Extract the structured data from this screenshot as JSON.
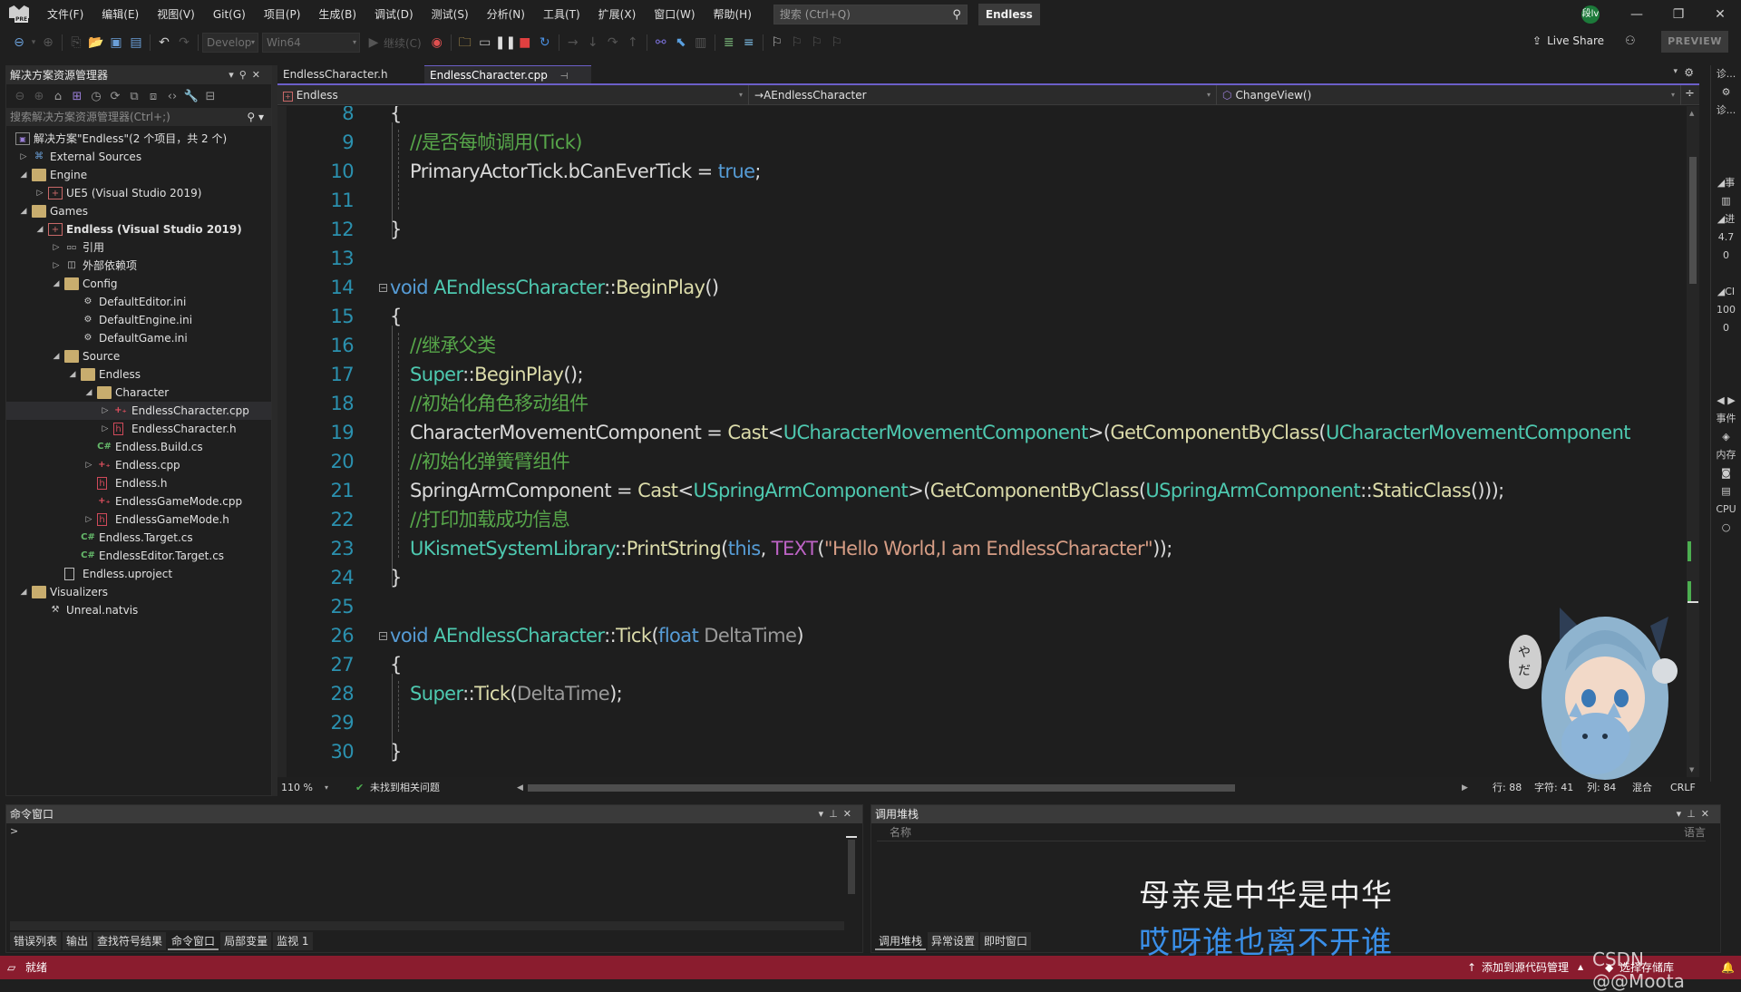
{
  "menu": {
    "items": [
      "文件(F)",
      "编辑(E)",
      "视图(V)",
      "Git(G)",
      "项目(P)",
      "生成(B)",
      "调试(D)",
      "测试(S)",
      "分析(N)",
      "工具(T)",
      "扩展(X)",
      "窗口(W)",
      "帮助(H)"
    ],
    "search_placeholder": "搜索 (Ctrl+Q)",
    "solution_name": "Endless",
    "account_initials": "段lv"
  },
  "toolbar": {
    "config": "Develop",
    "platform": "Win64",
    "continue_label": "继续(C)",
    "live_share": "Live Share",
    "preview": "PREVIEW"
  },
  "solution_explorer": {
    "title": "解决方案资源管理器",
    "search_placeholder": "搜索解决方案资源管理器(Ctrl+;)",
    "items": [
      {
        "label": "解决方案\"Endless\"(2 个项目，共 2 个)",
        "depth": 0,
        "icon": "solution",
        "arrow": ""
      },
      {
        "label": "External Sources",
        "depth": 1,
        "icon": "external",
        "arrow": "collapsed"
      },
      {
        "label": "Engine",
        "depth": 1,
        "icon": "folder",
        "arrow": "expanded"
      },
      {
        "label": "UE5 (Visual Studio 2019)",
        "depth": 2,
        "icon": "project",
        "arrow": "collapsed"
      },
      {
        "label": "Games",
        "depth": 1,
        "icon": "folder",
        "arrow": "expanded"
      },
      {
        "label": "Endless (Visual Studio 2019)",
        "depth": 2,
        "icon": "project",
        "arrow": "expanded",
        "bold": true
      },
      {
        "label": "引用",
        "depth": 3,
        "icon": "references",
        "arrow": "collapsed"
      },
      {
        "label": "外部依赖项",
        "depth": 3,
        "icon": "dependencies",
        "arrow": "collapsed"
      },
      {
        "label": "Config",
        "depth": 3,
        "icon": "filter-folder",
        "arrow": "expanded"
      },
      {
        "label": "DefaultEditor.ini",
        "depth": 4,
        "icon": "config-file",
        "arrow": ""
      },
      {
        "label": "DefaultEngine.ini",
        "depth": 4,
        "icon": "config-file",
        "arrow": ""
      },
      {
        "label": "DefaultGame.ini",
        "depth": 4,
        "icon": "config-file",
        "arrow": ""
      },
      {
        "label": "Source",
        "depth": 3,
        "icon": "filter-folder",
        "arrow": "expanded"
      },
      {
        "label": "Endless",
        "depth": 4,
        "icon": "filter-folder",
        "arrow": "expanded"
      },
      {
        "label": "Character",
        "depth": 5,
        "icon": "filter-folder",
        "arrow": "expanded"
      },
      {
        "label": "EndlessCharacter.cpp",
        "depth": 6,
        "icon": "cpp",
        "arrow": "collapsed",
        "selected": true
      },
      {
        "label": "EndlessCharacter.h",
        "depth": 6,
        "icon": "header",
        "arrow": "collapsed"
      },
      {
        "label": "Endless.Build.cs",
        "depth": 5,
        "icon": "csharp",
        "arrow": ""
      },
      {
        "label": "Endless.cpp",
        "depth": 5,
        "icon": "cpp",
        "arrow": "collapsed"
      },
      {
        "label": "Endless.h",
        "depth": 5,
        "icon": "header",
        "arrow": ""
      },
      {
        "label": "EndlessGameMode.cpp",
        "depth": 5,
        "icon": "cpp",
        "arrow": ""
      },
      {
        "label": "EndlessGameMode.h",
        "depth": 5,
        "icon": "header",
        "arrow": "collapsed"
      },
      {
        "label": "Endless.Target.cs",
        "depth": 4,
        "icon": "csharp",
        "arrow": ""
      },
      {
        "label": "EndlessEditor.Target.cs",
        "depth": 4,
        "icon": "csharp",
        "arrow": ""
      },
      {
        "label": "Endless.uproject",
        "depth": 3,
        "icon": "file",
        "arrow": ""
      },
      {
        "label": "Visualizers",
        "depth": 1,
        "icon": "folder",
        "arrow": "expanded"
      },
      {
        "label": "Unreal.natvis",
        "depth": 2,
        "icon": "natvis",
        "arrow": ""
      }
    ]
  },
  "editor": {
    "tabs": [
      {
        "label": "EndlessCharacter.h",
        "active": false
      },
      {
        "label": "EndlessCharacter.cpp",
        "active": true
      }
    ],
    "nav": {
      "project": "Endless",
      "scope": "AEndlessCharacter",
      "member": "ChangeView()"
    },
    "zoom": "110 %",
    "issues": "未找到相关问题",
    "line_label": "行: 88",
    "char_label": "字符: 41",
    "col_label": "列: 84",
    "indent": "混合",
    "eol": "CRLF",
    "lines": [
      {
        "n": 8,
        "tokens": [
          [
            "{",
            "w"
          ]
        ]
      },
      {
        "n": 9,
        "tokens": [
          [
            "//是否每帧调用(Tick)",
            "c_"
          ]
        ]
      },
      {
        "n": 10,
        "tokens": [
          [
            "PrimaryActorTick.bCanEverTick = ",
            "w"
          ],
          [
            "true",
            "k"
          ],
          [
            ";",
            "w"
          ]
        ]
      },
      {
        "n": 11,
        "tokens": []
      },
      {
        "n": 12,
        "tokens": [
          [
            "}",
            "w"
          ]
        ]
      },
      {
        "n": 13,
        "tokens": []
      },
      {
        "n": 14,
        "tokens": [
          [
            "void ",
            "k"
          ],
          [
            "AEndlessCharacter",
            "t"
          ],
          [
            "::",
            "w"
          ],
          [
            "BeginPlay",
            "f"
          ],
          [
            "()",
            "w"
          ]
        ],
        "fold": true
      },
      {
        "n": 15,
        "tokens": [
          [
            "{",
            "w"
          ]
        ]
      },
      {
        "n": 16,
        "tokens": [
          [
            "//继承父类",
            "c_"
          ]
        ]
      },
      {
        "n": 17,
        "tokens": [
          [
            "Super",
            "t"
          ],
          [
            "::",
            "w"
          ],
          [
            "BeginPlay",
            "f"
          ],
          [
            "();",
            "w"
          ]
        ]
      },
      {
        "n": 18,
        "tokens": [
          [
            "//初始化角色移动组件",
            "c_"
          ]
        ]
      },
      {
        "n": 19,
        "tokens": [
          [
            "CharacterMovementComponent = ",
            "w"
          ],
          [
            "Cast",
            "f"
          ],
          [
            "<",
            "w"
          ],
          [
            "UCharacterMovementComponent",
            "t"
          ],
          [
            ">(",
            "w"
          ],
          [
            "GetComponentByClass",
            "f"
          ],
          [
            "(",
            "w"
          ],
          [
            "UCharacterMovementComponent",
            "t"
          ]
        ]
      },
      {
        "n": 20,
        "tokens": [
          [
            "//初始化弹簧臂组件",
            "c_"
          ]
        ]
      },
      {
        "n": 21,
        "tokens": [
          [
            "SpringArmComponent = ",
            "w"
          ],
          [
            "Cast",
            "f"
          ],
          [
            "<",
            "w"
          ],
          [
            "USpringArmComponent",
            "t"
          ],
          [
            ">(",
            "w"
          ],
          [
            "GetComponentByClass",
            "f"
          ],
          [
            "(",
            "w"
          ],
          [
            "USpringArmComponent",
            "t"
          ],
          [
            "::",
            "w"
          ],
          [
            "StaticClass",
            "f"
          ],
          [
            "()));",
            "w"
          ]
        ]
      },
      {
        "n": 22,
        "tokens": [
          [
            "//打印加载成功信息",
            "c_"
          ]
        ]
      },
      {
        "n": 23,
        "tokens": [
          [
            "UKismetSystemLibrary",
            "t"
          ],
          [
            "::",
            "w"
          ],
          [
            "PrintString",
            "f"
          ],
          [
            "(",
            "w"
          ],
          [
            "this",
            "k"
          ],
          [
            ", ",
            "w"
          ],
          [
            "TEXT",
            "m"
          ],
          [
            "(",
            "w"
          ],
          [
            "\"Hello World,I am EndlessCharacter\"",
            "s"
          ],
          [
            "));",
            "w"
          ]
        ]
      },
      {
        "n": 24,
        "tokens": [
          [
            "}",
            "w"
          ]
        ]
      },
      {
        "n": 25,
        "tokens": []
      },
      {
        "n": 26,
        "tokens": [
          [
            "void ",
            "k"
          ],
          [
            "AEndlessCharacter",
            "t"
          ],
          [
            "::",
            "w"
          ],
          [
            "Tick",
            "f"
          ],
          [
            "(",
            "w"
          ],
          [
            "float ",
            "k"
          ],
          [
            "DeltaTime",
            "p"
          ],
          [
            ")",
            "w"
          ]
        ],
        "fold": true
      },
      {
        "n": 27,
        "tokens": [
          [
            "{",
            "w"
          ]
        ]
      },
      {
        "n": 28,
        "tokens": [
          [
            "Super",
            "t"
          ],
          [
            "::",
            "w"
          ],
          [
            "Tick",
            "f"
          ],
          [
            "(",
            "w"
          ],
          [
            "DeltaTime",
            "p"
          ],
          [
            ");",
            "w"
          ]
        ]
      },
      {
        "n": 29,
        "tokens": []
      },
      {
        "n": 30,
        "tokens": [
          [
            "}",
            "w"
          ]
        ]
      }
    ]
  },
  "right_strip": [
    "诊...",
    "⚙",
    "诊...",
    "◢事",
    "▥",
    "◢进",
    "4.7",
    "0",
    "◢CI",
    "100",
    "0",
    "◀ ▶",
    "事件",
    "◈",
    "内存",
    "◙",
    "▤",
    "CPU",
    "○"
  ],
  "command_window": {
    "title": "命令窗口",
    "prompt": ">",
    "tabs": [
      {
        "label": "错误列表",
        "active": false
      },
      {
        "label": "输出",
        "active": false
      },
      {
        "label": "查找符号结果",
        "active": false
      },
      {
        "label": "命令窗口",
        "active": true
      },
      {
        "label": "局部变量",
        "active": false
      },
      {
        "label": "监视 1",
        "active": false
      }
    ]
  },
  "call_stack": {
    "title": "调用堆栈",
    "col_name": "名称",
    "col_lang": "语言",
    "tabs": [
      {
        "label": "调用堆栈",
        "active": true
      },
      {
        "label": "异常设置",
        "active": false
      },
      {
        "label": "即时窗口",
        "active": false
      }
    ]
  },
  "overlay": {
    "lyric_line1": "母亲是中华是中华",
    "lyric_line2": "哎呀谁也离不开谁",
    "watermark": "CSDN @@Moota",
    "mascot_bubble": "やだ。"
  },
  "statusbar": {
    "ready": "就绪",
    "add_source_control": "添加到源代码管理",
    "select_repo": "选择存储库"
  },
  "colors": {
    "accent": "#6b5fc8",
    "statusbar": "#8a1c2e",
    "keyword": "#569cd6",
    "type": "#4ec9b0",
    "function": "#dcdcaa",
    "comment": "#57a64a",
    "string": "#d69d85",
    "line_number": "#2b91af"
  }
}
